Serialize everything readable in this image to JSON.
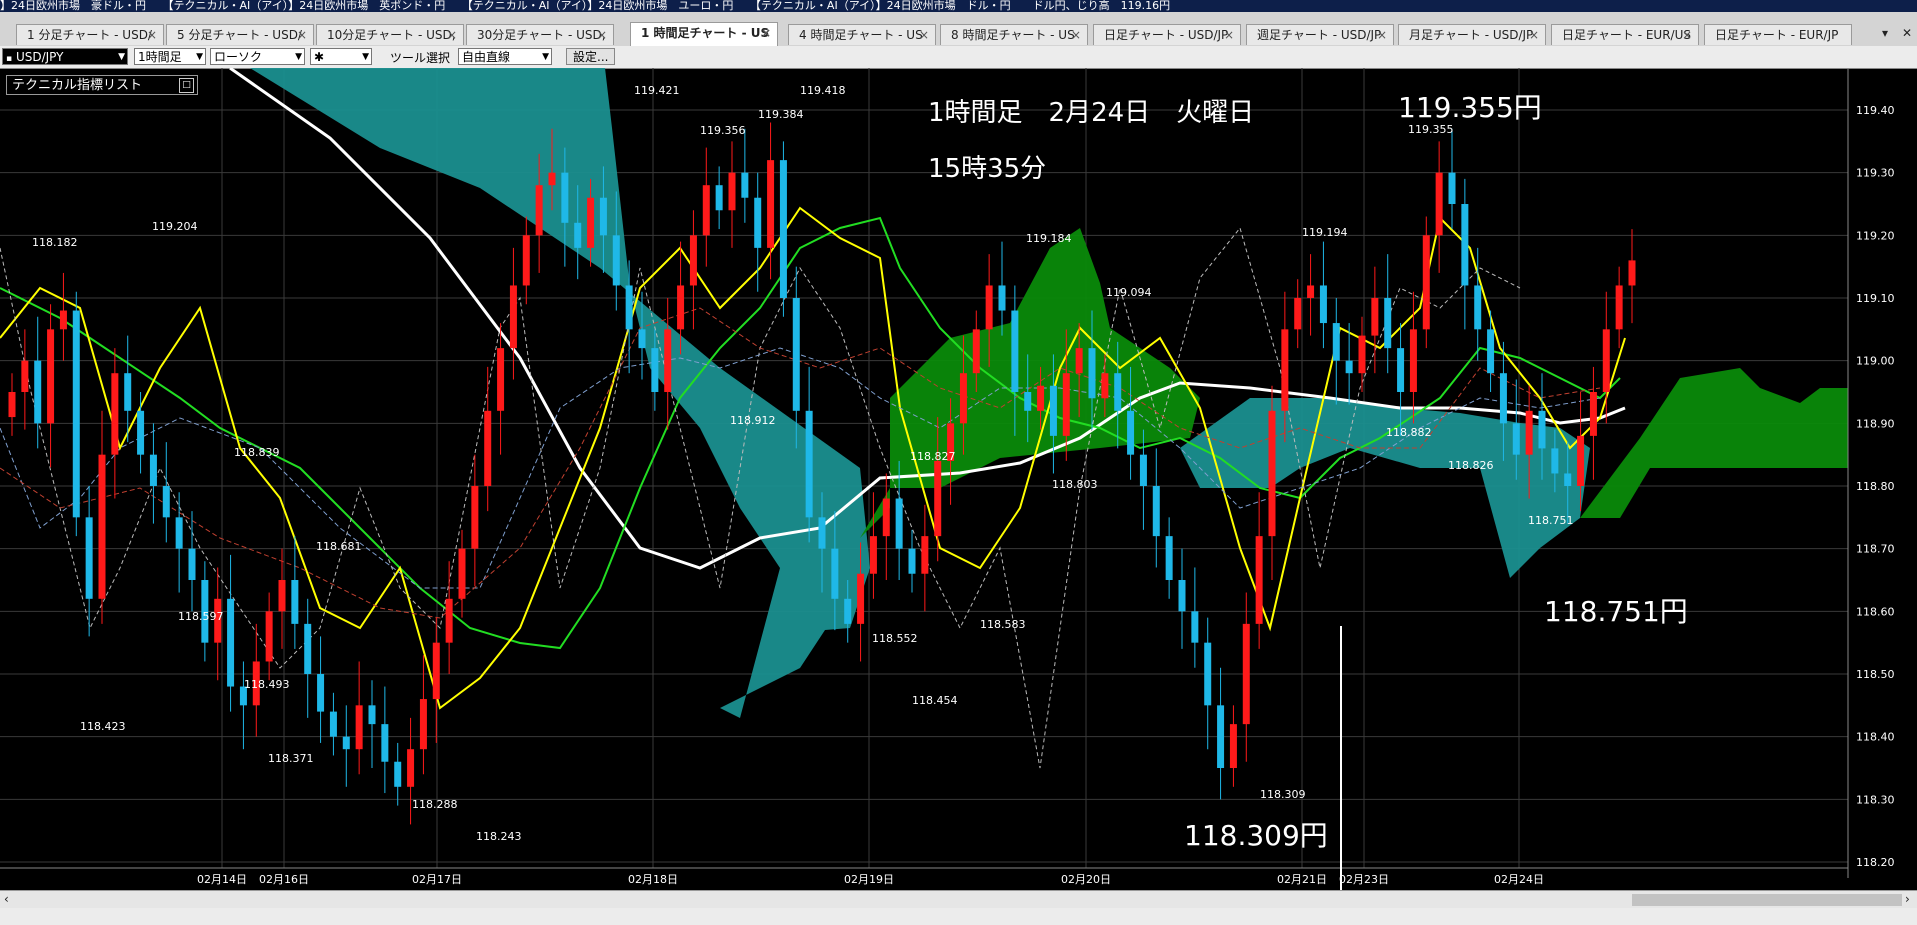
{
  "ticker": "】24日欧州市場　豪ドル・円　　【テクニカル・AI（アイ）】24日欧州市場　英ポンド・円　　【テクニカル・AI（アイ）】24日欧州市場　ユーロ・円　　【テクニカル・AI（アイ）】24日欧州市場　ドル・円　　ドル円、じり高　119.16円",
  "tabs": [
    {
      "label": "1 分足チャート - USD/"
    },
    {
      "label": "5 分足チャート - USD/"
    },
    {
      "label": "10分足チャート - USD,"
    },
    {
      "label": "30分足チャート - USD,"
    },
    {
      "label": "1 時間足チャート - US"
    },
    {
      "label": "4 時間足チャート - US"
    },
    {
      "label": "8 時間足チャート - US"
    },
    {
      "label": "日足チャート - USD/JP"
    },
    {
      "label": "週足チャート - USD/JP"
    },
    {
      "label": "月足チャート - USD/JP"
    },
    {
      "label": "日足チャート - EUR/US"
    },
    {
      "label": "日足チャート - EUR/JP"
    }
  ],
  "toolbar": {
    "symbol": "USD/JPY",
    "timeframe": "1時間足",
    "chart_type": "ローソク",
    "marker": "✱",
    "tool_label": "ツール選択",
    "tool_value": "自由直線",
    "settings": "設定..."
  },
  "indicator_panel": {
    "title": "テクニカル指標リスト"
  },
  "annotations": {
    "date": "1時間足　2月24日　火曜日",
    "time": "15時35分",
    "high": "119.355円",
    "low1": "118.309円",
    "low2": "118.751円"
  },
  "colors": {
    "up": "#ff1a1a",
    "down": "#1fb8e8",
    "ma_short": "#ffff00",
    "ma_mid": "#22dd22",
    "ma_long": "#ffffff",
    "cloud_bull": "#0a8a0a",
    "cloud_bear": "#1a8f8f"
  },
  "chart_data": {
    "type": "candlestick",
    "symbol": "USD/JPY",
    "timeframe": "1時間足",
    "ylim": [
      118.2,
      119.4
    ],
    "y_ticks": [
      "119.40",
      "119.30",
      "119.20",
      "119.10",
      "119.00",
      "118.90",
      "118.80",
      "118.70",
      "118.60",
      "118.50",
      "118.40",
      "118.30",
      "118.20"
    ],
    "x_labels": [
      "02月14日",
      "02月16日",
      "02月17日",
      "02月18日",
      "02月19日",
      "02月20日",
      "02月21日",
      "02月23日",
      "02月24日"
    ],
    "price_labels": [
      "118.182",
      "119.204",
      "118.423",
      "118.597",
      "118.839",
      "118.493",
      "118.681",
      "118.371",
      "118.288",
      "118.243",
      "119.421",
      "119.356",
      "119.384",
      "119.418",
      "118.912",
      "118.552",
      "118.454",
      "118.827",
      "118.583",
      "119.184",
      "118.803",
      "119.094",
      "118.309",
      "119.194",
      "118.882",
      "119.355",
      "118.826",
      "118.751"
    ],
    "last_close": 119.16,
    "key_high": 119.355,
    "key_lows": [
      118.309,
      118.751
    ]
  }
}
